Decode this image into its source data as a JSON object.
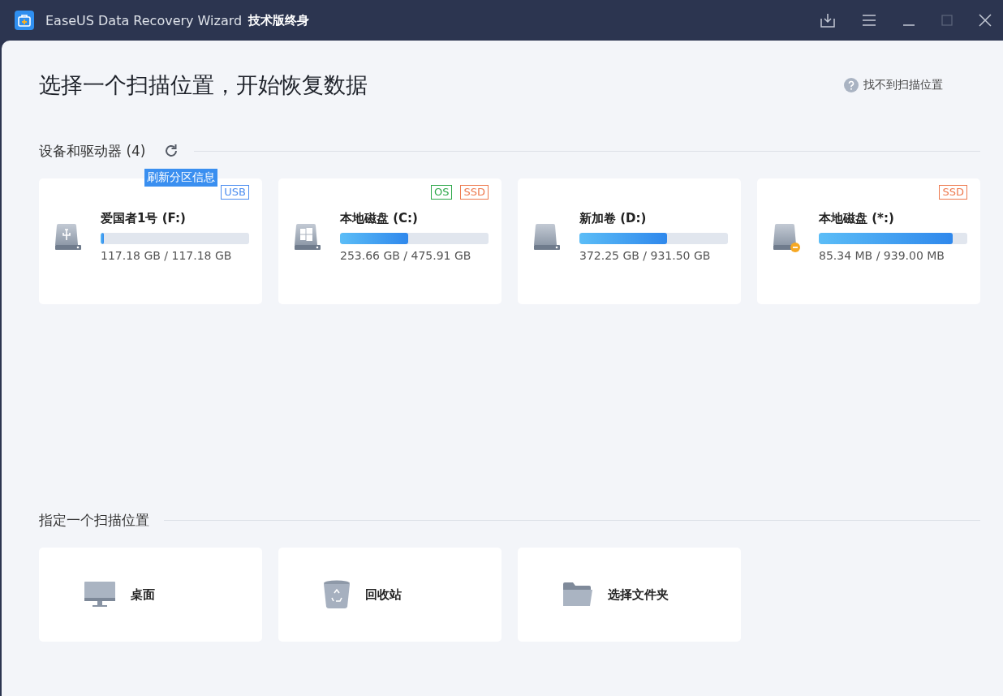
{
  "window": {
    "title": "EaseUS Data Recovery Wizard",
    "edition": "技术版终身"
  },
  "heading": "选择一个扫描位置，开始恢复数据",
  "help_link": "找不到扫描位置",
  "devices": {
    "title": "设备和驱动器 (4)",
    "tooltip": "刷新分区信息",
    "drives": [
      {
        "kind": "usb",
        "name": "爱国者1号 (F:)",
        "level": 0.02,
        "usage": "117.18 GB / 117.18 GB",
        "tags": [
          {
            "label": "USB",
            "color": "#4d8ef0"
          }
        ]
      },
      {
        "kind": "windows",
        "name": "本地磁盘 (C:)",
        "level": 0.46,
        "usage": "253.66 GB / 475.91 GB",
        "tags": [
          {
            "label": "OS",
            "color": "#2ea84a"
          },
          {
            "label": "SSD",
            "color": "#ee7a4f"
          }
        ]
      },
      {
        "kind": "plain",
        "name": "新加卷 (D:)",
        "level": 0.59,
        "usage": "372.25 GB / 931.50 GB"
      },
      {
        "kind": "warning",
        "name": "本地磁盘 (*:)",
        "level": 0.9,
        "usage": "85.34 MB / 939.00 MB",
        "tags": [
          {
            "label": "SSD",
            "color": "#ee7a4f"
          }
        ]
      }
    ]
  },
  "locations": {
    "title": "指定一个扫描位置",
    "items": [
      {
        "kind": "desktop",
        "label": "桌面"
      },
      {
        "kind": "recycle",
        "label": "回收站"
      },
      {
        "kind": "folder",
        "label": "选择文件夹"
      }
    ]
  }
}
